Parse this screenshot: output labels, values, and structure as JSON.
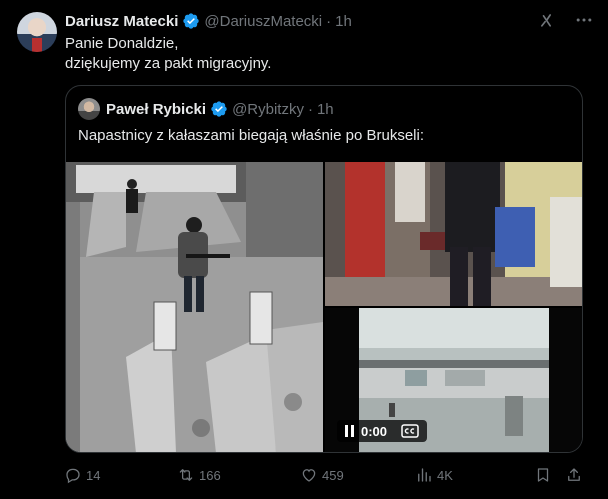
{
  "tweet": {
    "author_name": "Dariusz Matecki",
    "handle": "@DariuszMatecki",
    "separator": "·",
    "time": "1h",
    "text_lines": [
      "Panie Donaldzie,",
      "dziękujemy za pakt migracyjny."
    ]
  },
  "quote": {
    "author_name": "Paweł Rybicki",
    "handle": "@Rybitzky",
    "separator": "·",
    "time": "1h",
    "text": "Napastnicy z kałaszami biegają właśnie po Brukseli:"
  },
  "video": {
    "time": "0:00",
    "caption_label": "CC"
  },
  "actions": {
    "replies": "14",
    "reposts": "166",
    "likes": "459",
    "views": "4K"
  },
  "colors": {
    "background": "#000000",
    "text": "#e7e9ea",
    "muted": "#71767b",
    "border": "#2f3336",
    "verified": "#1d9bf0"
  },
  "icons": [
    "verified-icon",
    "grok-icon",
    "more-icon",
    "pause-icon",
    "cc-icon",
    "reply-icon",
    "repost-icon",
    "like-icon",
    "views-icon",
    "bookmark-icon",
    "share-icon"
  ]
}
